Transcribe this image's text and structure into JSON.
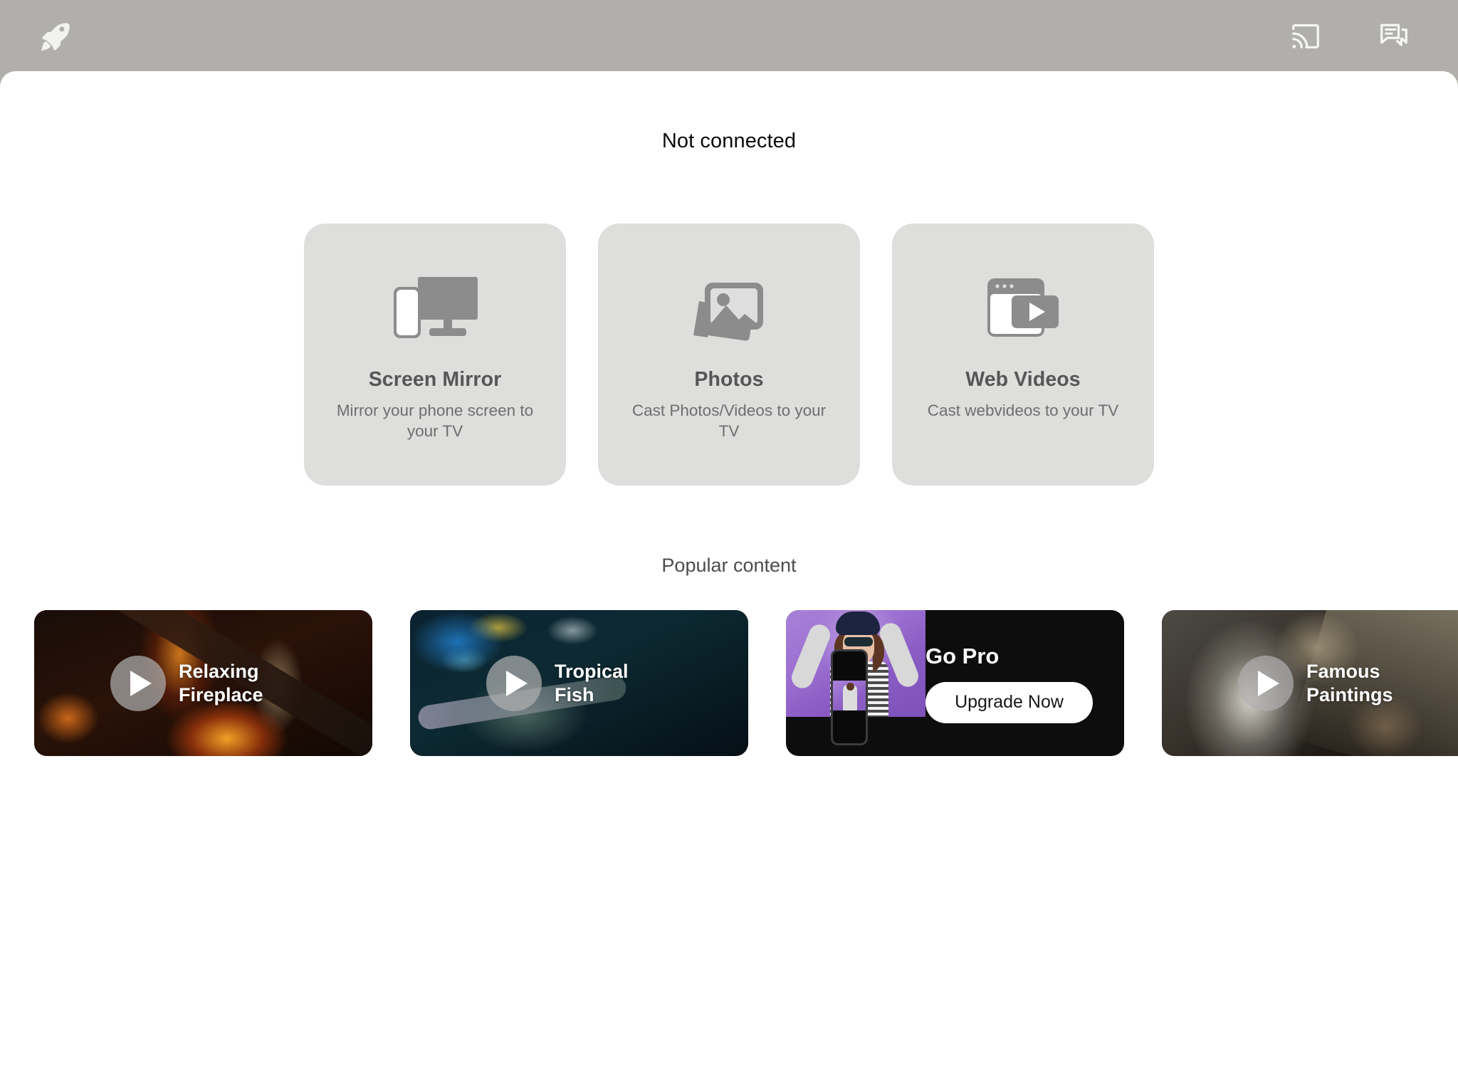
{
  "topbar": {
    "logo_icon": "rocket-icon",
    "cast_icon": "cast-icon",
    "feedback_icon": "chat-feedback-icon",
    "background_color": "#b0afab"
  },
  "status": {
    "text": "Not connected"
  },
  "features": [
    {
      "id": "screen-mirror",
      "icon": "tv-phone-mirror-icon",
      "title": "Screen Mirror",
      "description": "Mirror your phone screen to your TV"
    },
    {
      "id": "photos",
      "icon": "photo-stack-icon",
      "title": "Photos",
      "description": "Cast Photos/Videos to your TV"
    },
    {
      "id": "web-videos",
      "icon": "browser-play-icon",
      "title": "Web Videos",
      "description": "Cast webvideos to your TV"
    }
  ],
  "popular": {
    "section_title": "Popular content",
    "items": [
      {
        "id": "relaxing-fireplace",
        "type": "video",
        "title_line1": "Relaxing",
        "title_line2": "Fireplace",
        "play_icon": "play-icon",
        "art": "fireplace-logs-flames"
      },
      {
        "id": "tropical-fish",
        "type": "video",
        "title_line1": "Tropical",
        "title_line2": "Fish",
        "play_icon": "play-icon",
        "art": "coral-reef-fish"
      },
      {
        "id": "go-pro",
        "type": "promo",
        "title": "Go Pro",
        "button_label": "Upgrade Now",
        "art": "woman-phone-mirroring"
      },
      {
        "id": "famous-paintings",
        "type": "video",
        "title_line1": "Famous",
        "title_line2": "Paintings",
        "play_icon": "play-icon",
        "art": "storm-sea-painting"
      }
    ]
  },
  "colors": {
    "topbar": "#b0afab",
    "panel": "#ffffff",
    "feature_card": "#dededd",
    "feature_title": "#565656",
    "feature_desc": "#6e6e6e",
    "status_text": "#0b0b0b",
    "section_title": "#4c4c4c",
    "promo_background": "#0d0d0d",
    "promo_button": "#ffffff"
  }
}
